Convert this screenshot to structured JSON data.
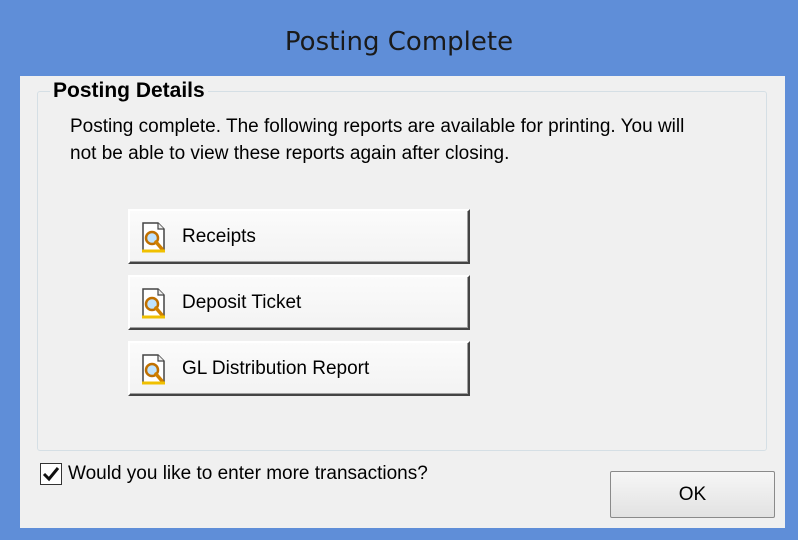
{
  "window": {
    "title": "Posting Complete"
  },
  "group": {
    "label": "Posting Details",
    "description": "Posting complete. The following reports are available for printing. You will not be able to view these reports again after closing."
  },
  "reports": [
    {
      "label": "Receipts",
      "icon": "report-preview-icon"
    },
    {
      "label": "Deposit Ticket",
      "icon": "report-preview-icon"
    },
    {
      "label": "GL Distribution Report",
      "icon": "report-preview-icon"
    }
  ],
  "more_transactions": {
    "label": "Would you like to enter more transactions?",
    "checked": true
  },
  "ok_button": {
    "label": "OK"
  },
  "colors": {
    "title_bar": "#5f8ed8",
    "client_bg": "#f0f0f0"
  }
}
